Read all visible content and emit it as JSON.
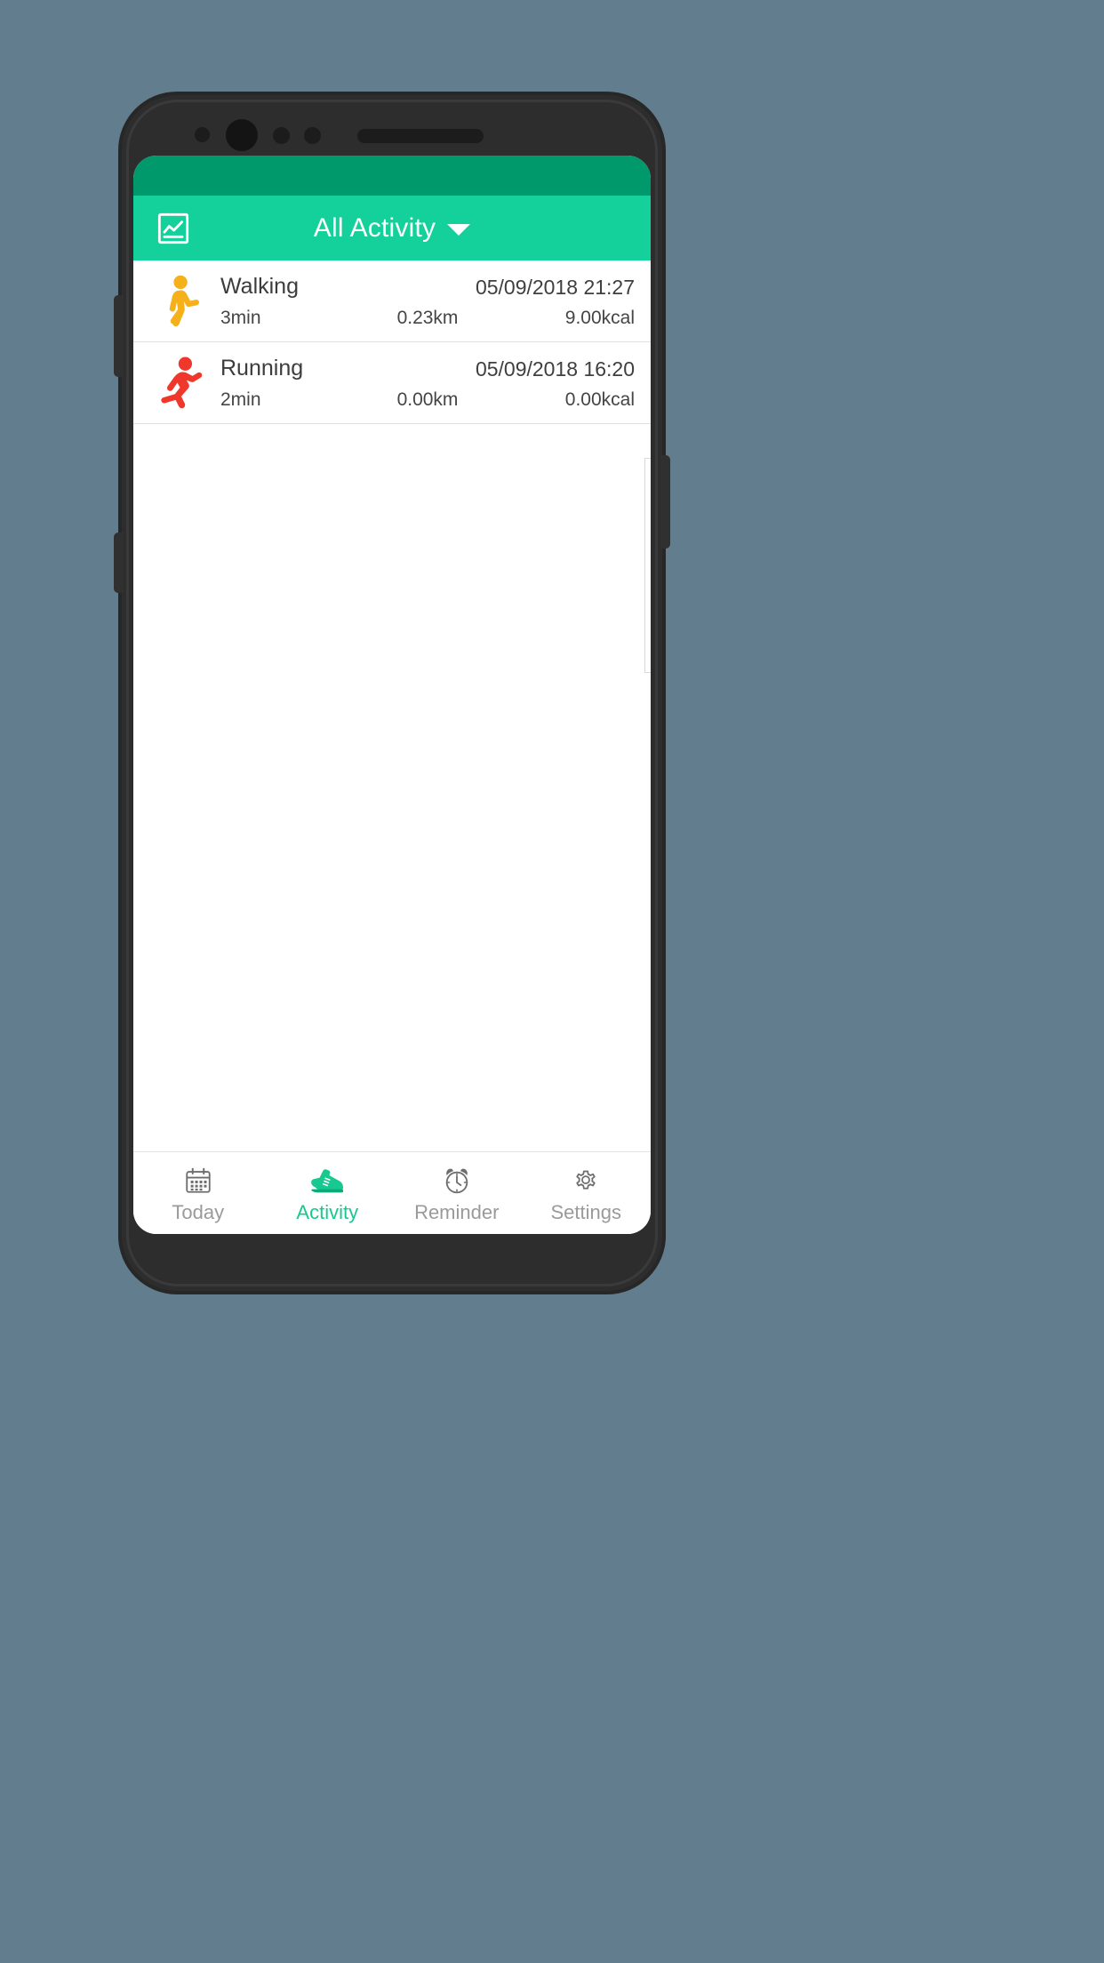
{
  "theme": {
    "background": "#627D8D",
    "status_bar": "#00996B",
    "app_bar": "#14D09A",
    "accent": "#17C98F",
    "walking_icon_color": "#F5B01A",
    "running_icon_color": "#F0372B",
    "inactive_nav": "#9a9a9a"
  },
  "app_bar": {
    "chart_icon": "chart-icon",
    "title": "All Activity",
    "caret_icon": "chevron-down-icon"
  },
  "activity_list": {
    "rows": [
      {
        "icon": "walking-icon",
        "title": "Walking",
        "date": "05/09/2018 21:27",
        "duration": "3min",
        "distance": "0.23km",
        "calories": "9.00kcal"
      },
      {
        "icon": "running-icon",
        "title": "Running",
        "date": "05/09/2018 16:20",
        "duration": "2min",
        "distance": "0.00km",
        "calories": "0.00kcal"
      }
    ]
  },
  "bottom_nav": {
    "items": [
      {
        "icon": "calendar-icon",
        "label": "Today",
        "active": false
      },
      {
        "icon": "sneaker-icon",
        "label": "Activity",
        "active": true
      },
      {
        "icon": "alarm-clock-icon",
        "label": "Reminder",
        "active": false
      },
      {
        "icon": "gear-icon",
        "label": "Settings",
        "active": false
      }
    ]
  }
}
